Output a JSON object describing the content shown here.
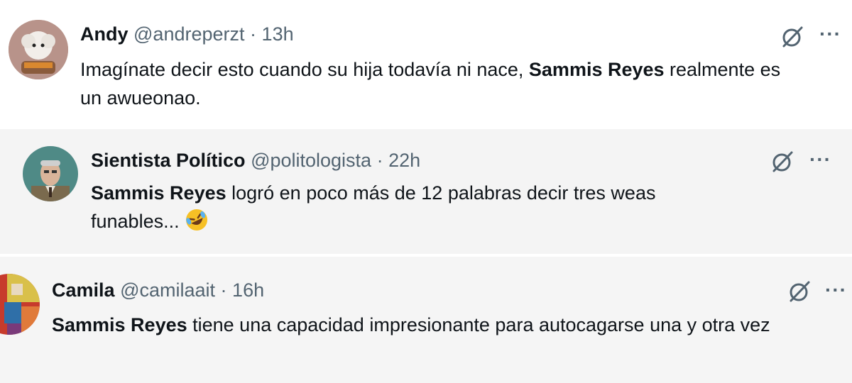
{
  "tweets": [
    {
      "name": "Andy",
      "handle": "@andreperzt",
      "separator": "·",
      "time": "13h",
      "text_before": "Imagínate decir esto cuando su hija todavía ni nace, ",
      "mention": "Sammis Reyes",
      "text_after": " realmente es un awueonao.",
      "avatar_icon": "dog-avatar-icon"
    },
    {
      "name": "Sientista Político",
      "handle": "@politologista",
      "separator": "·",
      "time": "22h",
      "mention": "Sammis Reyes",
      "text_after": " logró en poco más de 12 palabras decir tres weas funables...",
      "emoji": "rolling-laughing-emoji",
      "avatar_icon": "man-portrait-avatar-icon"
    },
    {
      "name": "Camila",
      "handle": "@camilaait",
      "separator": "·",
      "time": "16h",
      "mention": "Sammis Reyes",
      "text_after": " tiene una capacidad impresionante para autocagarse una y otra vez",
      "avatar_icon": "colorful-avatar-icon"
    }
  ],
  "icons": {
    "grok": "grok-icon",
    "more": "more-icon",
    "more_glyph": "···"
  },
  "colors": {
    "text": "#0f1419",
    "muted": "#536471",
    "bg_reply": "#f4f4f4"
  }
}
